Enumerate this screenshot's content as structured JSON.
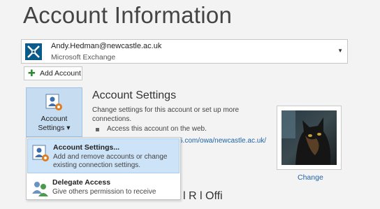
{
  "page": {
    "title": "Account Information"
  },
  "account": {
    "email": "Andy.Hedman@newcastle.ac.uk",
    "type": "Microsoft Exchange",
    "dropdown_icon": "caret-down-icon"
  },
  "add_account": {
    "label": "Add Account",
    "icon": "plus-icon"
  },
  "account_settings_button": {
    "line1": "Account",
    "line2": "Settings ▾",
    "icon": "account-settings-icon"
  },
  "section": {
    "heading": "Account Settings",
    "description": "Change settings for this account or set up more connections.",
    "bullet": "Access this account on the web.",
    "link": "5.com/owa/newcastle.ac.uk/"
  },
  "profile": {
    "change_label": "Change"
  },
  "menu": {
    "items": [
      {
        "title": "Account Settings...",
        "description": "Add and remove accounts or change existing connection settings.",
        "icon": "account-settings-icon"
      },
      {
        "title": "Delegate Access",
        "description": "Give others permission to receive",
        "icon": "delegate-access-icon"
      }
    ]
  },
  "colors": {
    "background": "#f3f3f3",
    "accent": "#c6dcf1",
    "menu_highlight": "#cde3f7",
    "link": "#1e63a7"
  },
  "partial_heading": "l R l   Offi"
}
